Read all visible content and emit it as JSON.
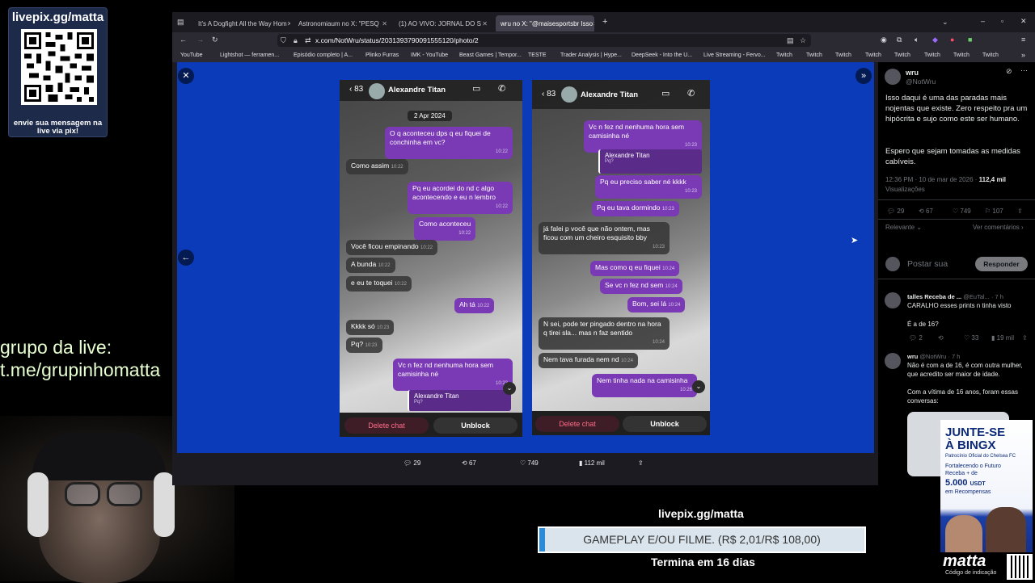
{
  "overlay": {
    "qr_header": "livepix.gg/matta",
    "qr_footer": "envie sua mensagem na live via pix!",
    "grupo_line1": "grupo da live:",
    "grupo_line2": "t.me/grupinhomatta"
  },
  "browser": {
    "tabs": [
      {
        "label": "It's A Dogfight All the Way Hom"
      },
      {
        "label": "Astronomiaum no X: \"PESQ"
      },
      {
        "label": "(1) AO VIVO: JORNAL DO S"
      },
      {
        "label": "wru no X: \"@maisesportsbr Isso"
      }
    ],
    "url": "x.com/NotWru/status/2031393790091555120/photo/2",
    "bookmarks": [
      "YouTube",
      "Lightshot — ferramen...",
      "Episódio completo | A...",
      "Plinko Furras",
      "IMK - YouTube",
      "Beast Games | Tempor...",
      "TESTE",
      "Trader Analysis | Hype...",
      "DeepSeek - Into the U...",
      "Live Streaming - Fervo...",
      "Twitch",
      "Twitch",
      "Twitch",
      "Twitch",
      "Twitch",
      "Twitch",
      "Twitch",
      "Twitch"
    ]
  },
  "phone1": {
    "back_count": "83",
    "contact": "Alexandre Titan",
    "date": "2 Apr 2024",
    "messages": [
      {
        "text": "O q aconteceu dps q eu fiquei de conchinha em vc?",
        "time": "10:22"
      },
      {
        "text": "Como assim",
        "time": "10:22"
      },
      {
        "text": "Pq eu acordei do nd c algo acontecendo e eu n lembro",
        "time": "10:22"
      },
      {
        "text": "Como aconteceu",
        "time": "10:22"
      },
      {
        "text": "Você ficou empinando",
        "time": "10:22"
      },
      {
        "text": "A bunda",
        "time": "10:22"
      },
      {
        "text": "e eu te toquei",
        "time": "10:22"
      },
      {
        "text": "Ah tá",
        "time": "10:22"
      },
      {
        "text": "Kkkk só",
        "time": "10:23"
      },
      {
        "text": "Pq?",
        "time": "10:23"
      },
      {
        "text": "Vc n fez nd nenhuma hora sem camisinha né",
        "time": "10:23"
      }
    ],
    "quote_name": "Alexandre Titan",
    "quote_sub": "Pq?",
    "delete": "Delete chat",
    "unblock": "Unblock"
  },
  "phone2": {
    "back_count": "83",
    "contact": "Alexandre Titan",
    "messages": [
      {
        "text": "Vc n fez nd nenhuma hora sem camisinha né",
        "time": "10:23"
      },
      {
        "text": "Pq eu preciso saber né kkkk",
        "time": "10:23"
      },
      {
        "text": "Pq eu tava dormindo",
        "time": "10:23"
      },
      {
        "text": "já falei p você que não ontem, mas ficou com um cheiro esquisito bby",
        "time": "10:23"
      },
      {
        "text": "Mas como q eu fiquei",
        "time": "10:24"
      },
      {
        "text": "Se vc n fez nd sem",
        "time": "10:24"
      },
      {
        "text": "Bom, sei lá",
        "time": "10:24"
      },
      {
        "text": "N sei, pode ter pingado dentro na hora q tirei sla... mas n faz sentido",
        "time": "10:24"
      },
      {
        "text": "Nem tava furada nem nd",
        "time": "10:24"
      },
      {
        "text": "Nem tinha nada na camisinha",
        "time": "10:26"
      }
    ],
    "quote_name": "Alexandre Titan",
    "quote_sub": "Pq?",
    "delete": "Delete chat",
    "unblock": "Unblock"
  },
  "image_actions": {
    "replies": "29",
    "reposts": "67",
    "likes": "749",
    "views": "112 mil"
  },
  "tweet": {
    "name": "wru",
    "handle": "@NotWru",
    "text1": "Isso daqui é uma das paradas mais nojentas que existe. Zero respeito pra um hipócrita e sujo como este ser humano.",
    "text2": "Espero que sejam tomadas as medidas cabíveis.",
    "meta": "12:36 PM · 10 de mar de 2026 ·",
    "views_count": "112,4 mil",
    "views_label": "Visualizações",
    "replies": "29",
    "reposts": "67",
    "likes": "749",
    "bookmarks": "107",
    "relevante": "Relevante",
    "ver": "Ver comentários",
    "post_placeholder": "Postar sua",
    "responder": "Responder"
  },
  "replies": [
    {
      "name": "talles Receba de ...",
      "handle": "@EuTal...",
      "time": "· 7 h",
      "text": "CARALHO esses prints n tinha visto",
      "text2": "É a de 16?",
      "replies": "2",
      "likes": "33",
      "views": "19 mil"
    },
    {
      "name": "wru",
      "handle": "@NotWru",
      "time": "· 7 h",
      "text": "Não é com a de 16, é com outra mulher, que acredito ser maior de idade.",
      "text2": "Com a vítima de 16 anos, foram essas conversas:"
    }
  ],
  "ad": {
    "title1": "JUNTE-SE",
    "title2": "À BINGX",
    "sub": "Patrocínio Oficial do Chelsea FC",
    "line1": "Fortalecendo o Futuro",
    "line2": "Receba + de",
    "amount": "5.000",
    "unit": "USDT",
    "line3": "em Recompensas",
    "brand": "matta",
    "brand_sub": "Código de indicação"
  },
  "donation": {
    "url": "livepix.gg/matta",
    "bar_text": "GAMEPLAY E/OU FILME. (R$ 2,01/R$ 108,00)",
    "progress": 0.0186,
    "ends": "Termina em 16 dias"
  },
  "colors": {
    "viewer_bg": "#0b3bb8",
    "bubble_me": "#7a39b5",
    "accent": "#1d9bf0"
  }
}
